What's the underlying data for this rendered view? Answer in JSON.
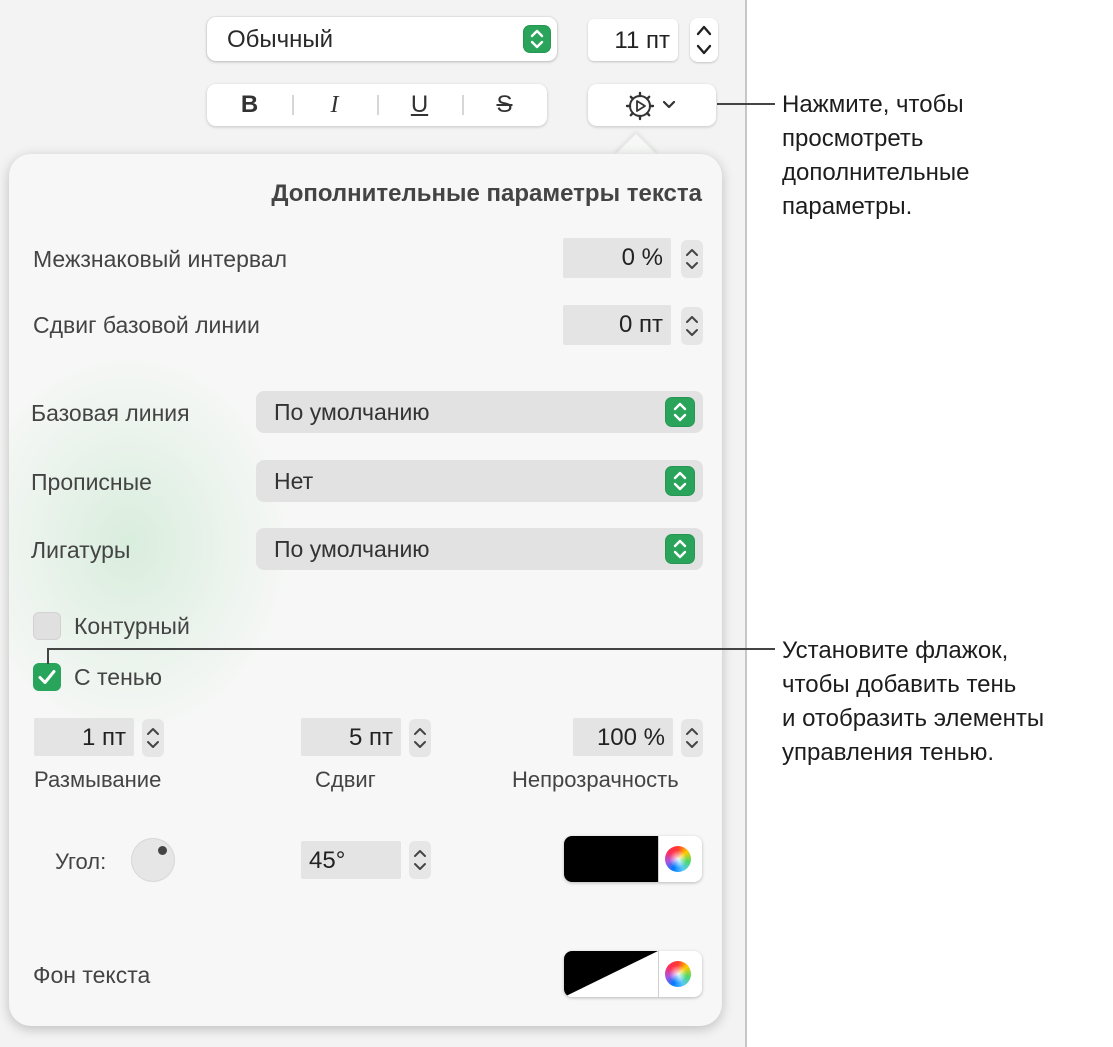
{
  "toolbar": {
    "style_value": "Обычный",
    "size_value": "11 пт",
    "bold_label": "B",
    "italic_label": "I",
    "underline_label": "U",
    "strike_label": "S",
    "gear_icon": "gear-icon",
    "chevron_icon": "chevron-down-icon"
  },
  "popover": {
    "title": "Дополнительные параметры текста",
    "char_spacing": {
      "label": "Межзнаковый интервал",
      "value": "0 %"
    },
    "baseline_shift": {
      "label": "Сдвиг базовой линии",
      "value": "0 пт"
    },
    "baseline": {
      "label": "Базовая линия",
      "value": "По умолчанию"
    },
    "capitalization": {
      "label": "Прописные",
      "value": "Нет"
    },
    "ligatures": {
      "label": "Лигатуры",
      "value": "По умолчанию"
    },
    "outline": {
      "label": "Контурный",
      "checked": false
    },
    "shadow": {
      "label": "С тенью",
      "checked": true
    },
    "shadow_controls": {
      "blur": {
        "label": "Размывание",
        "value": "1 пт"
      },
      "offset": {
        "label": "Сдвиг",
        "value": "5 пт"
      },
      "opacity": {
        "label": "Непрозрачность",
        "value": "100 %"
      },
      "angle": {
        "label": "Угол:",
        "value": "45°"
      },
      "color": "#000000"
    },
    "text_background": {
      "label": "Фон текста"
    }
  },
  "callouts": {
    "top": [
      "Нажмите, чтобы",
      "просмотреть",
      "дополнительные",
      "параметры."
    ],
    "bottom": [
      "Установите флажок,",
      "чтобы добавить тень",
      "и отобразить элементы",
      "управления тенью."
    ]
  },
  "colors": {
    "accent_green": "#2aa45a",
    "panel_bg": "#f3f3f3"
  }
}
